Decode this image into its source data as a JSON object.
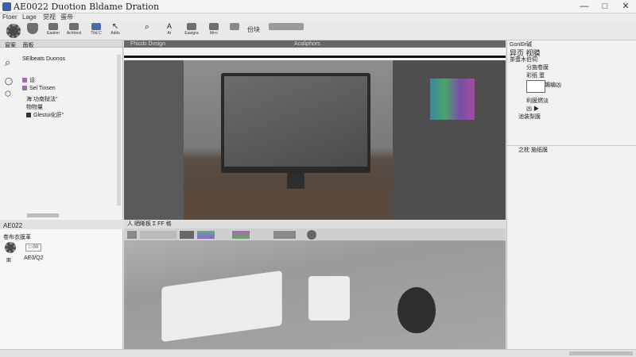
{
  "window": {
    "title": "AE0022 Duotion Bldame Dration",
    "minimize": "—",
    "maximize": "□",
    "close": "✕"
  },
  "menu": [
    "Ftoer",
    "Lage",
    "觉视",
    "蛋帝"
  ],
  "toolbar": [
    {
      "label": "",
      "icon": "gear-icon"
    },
    {
      "label": "",
      "icon": "shield-icon"
    },
    {
      "label": "Eadem",
      "icon": "film-icon"
    },
    {
      "label": "Achtrest",
      "icon": "film-icon"
    },
    {
      "label": "Titd C",
      "icon": "panel-icon"
    },
    {
      "label": "Adds",
      "icon": "cursor-icon"
    },
    {
      "label": "",
      "icon": "search-icon"
    },
    {
      "label": "Ar",
      "icon": "text-icon"
    },
    {
      "label": "Eastgra",
      "icon": "image-icon"
    },
    {
      "label": "Mrrc",
      "icon": "layers-icon"
    },
    {
      "label": "",
      "icon": "grid-icon"
    },
    {
      "label": "份块",
      "icon": "block-icon"
    },
    {
      "label": "",
      "icon": "mode-icon"
    }
  ],
  "left_panel": {
    "tabs": [
      "窗案",
      "面板"
    ],
    "items": [
      "SElbeats Duonos",
      "设",
      "Sel Tinsen",
      "海 功南狱法\"",
      "物物量",
      "Glestui化肝\""
    ]
  },
  "left_bottom": {
    "title": "AE022",
    "subtitle": "卷布衣膜革",
    "control_label": "□ 00",
    "value": "AE0/Q2",
    "caption": "面"
  },
  "viewer": {
    "tab_left": "Fhicds Dvsign",
    "tab_right": "Acaliphors"
  },
  "bottom_view": {
    "tab": "人 晒晰板  Σ FF 格"
  },
  "right_panel": {
    "header": "Gonl0r碱",
    "title": "异页 视膜",
    "rows": [
      "茶蛋木伯伺",
      "分施卷膜",
      "彩纸 蛋",
      "砸媚编凶",
      "利膜燃淡",
      "凶 ▶",
      "池装梨膜",
      "之枕 施纸膜"
    ]
  },
  "status": {
    "text": ""
  }
}
